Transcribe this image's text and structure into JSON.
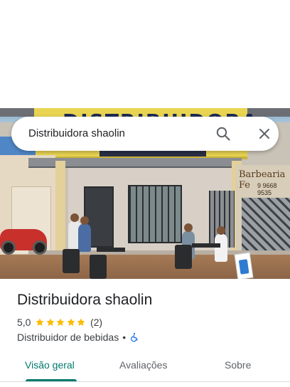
{
  "search": {
    "query": "Distribuidora shaolin"
  },
  "photo": {
    "sign_text": "DISTRIBUIDORA",
    "neighbor_sign": "Barbearia Fe",
    "neighbor_phone": "9 9668 9535"
  },
  "place": {
    "name": "Distribuidora shaolin",
    "rating": "5,0",
    "stars": 5,
    "review_count": "(2)",
    "category": "Distribuidor de bebidas",
    "separator": "•"
  },
  "tabs": [
    {
      "label": "Visão geral",
      "active": true
    },
    {
      "label": "Avaliações",
      "active": false
    },
    {
      "label": "Sobre",
      "active": false
    }
  ],
  "colors": {
    "accent": "#00796b",
    "star": "#fbbc04",
    "accessibility": "#1a73e8"
  },
  "icons": {
    "search": "search-icon",
    "close": "close-icon",
    "wheelchair": "wheelchair-icon",
    "star": "star-icon"
  }
}
